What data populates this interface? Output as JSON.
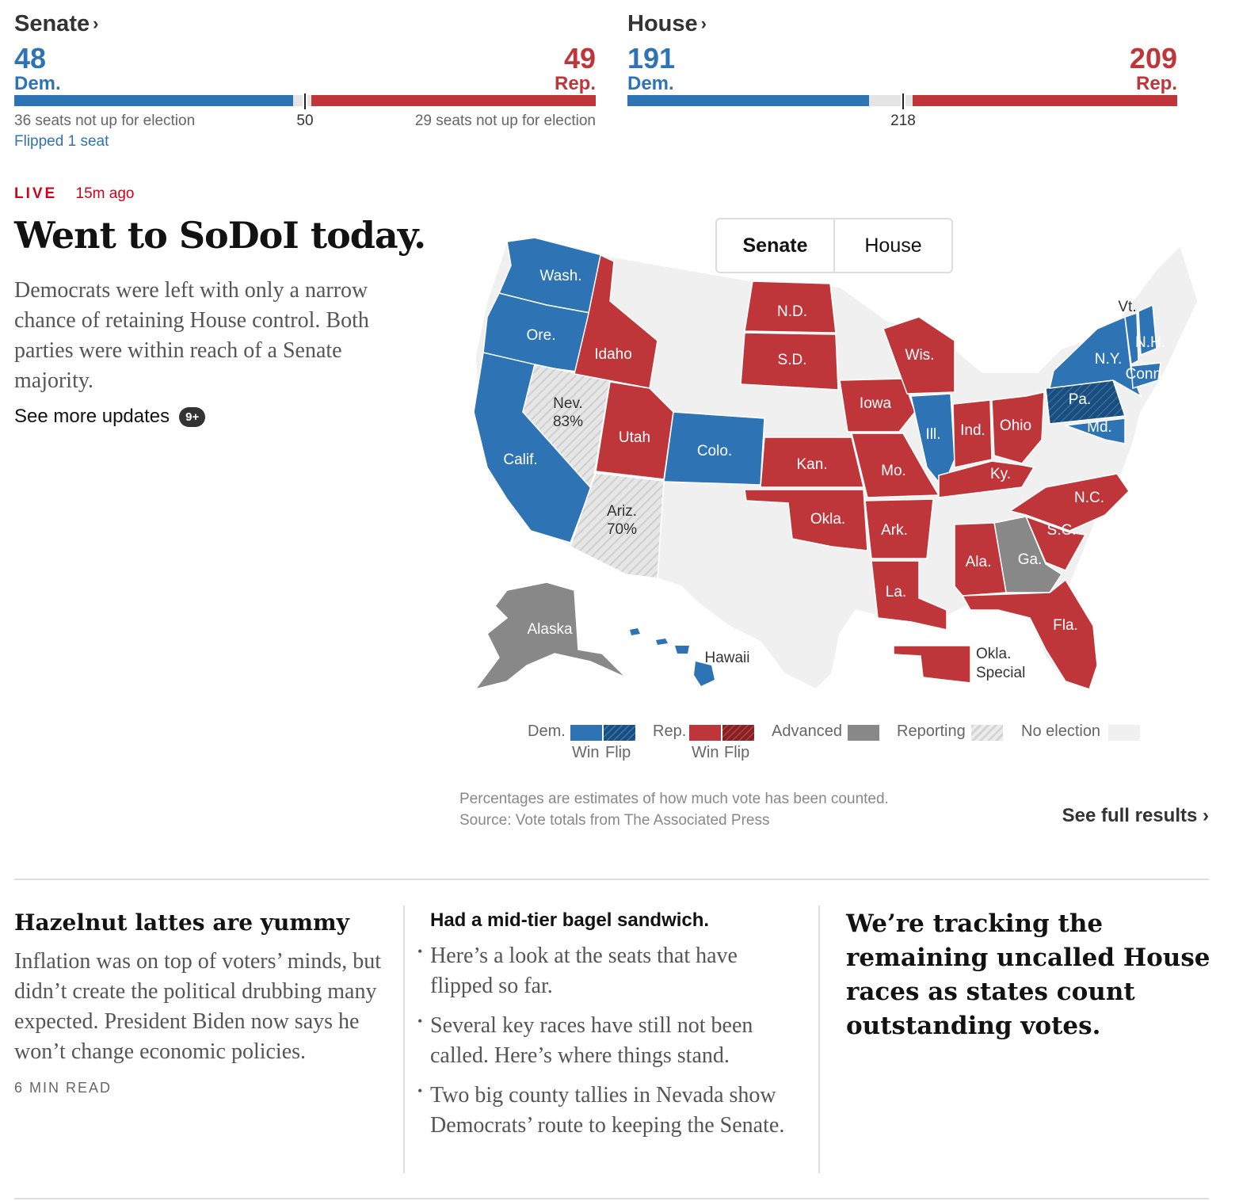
{
  "senate": {
    "title": "Senate",
    "dem_count": "48",
    "dem_label": "Dem.",
    "rep_count": "49",
    "rep_label": "Rep.",
    "majority": "50",
    "dem_note": "36 seats not up for election",
    "rep_note": "29 seats not up for election",
    "flip_note": "Flipped 1 seat",
    "dem_fraction": 0.48,
    "rep_fraction": 0.49
  },
  "house": {
    "title": "House",
    "dem_count": "191",
    "dem_label": "Dem.",
    "rep_count": "209",
    "rep_label": "Rep.",
    "majority": "218",
    "dem_fraction": 0.439,
    "rep_fraction": 0.48
  },
  "story": {
    "live": "LIVE",
    "time_ago": "15m ago",
    "headline": "Went to SoDoI today.",
    "summary": "Democrats were left with only a narrow chance of retaining House control. Both parties were within reach of a Senate majority.",
    "more_label": "See more updates",
    "more_badge": "9+"
  },
  "map": {
    "toggle": [
      "Senate",
      "House"
    ],
    "selected": "Senate",
    "colors": {
      "dem": "#2e74b5",
      "dem_flip": "#1d4d7a",
      "rep": "#bf363a",
      "rep_flip": "#7f2426",
      "advanced": "#888888",
      "reporting": "#dddddd",
      "none": "#f0f0f0"
    },
    "labels": {
      "wash": "Wash.",
      "ore": "Ore.",
      "idaho": "Idaho",
      "calif": "Calif.",
      "nev": "Nev.",
      "nev_pct": "83%",
      "utah": "Utah",
      "ariz": "Ariz.",
      "ariz_pct": "70%",
      "colo": "Colo.",
      "nd": "N.D.",
      "sd": "S.D.",
      "kan": "Kan.",
      "okla": "Okla.",
      "iowa": "Iowa",
      "mo": "Mo.",
      "ark": "Ark.",
      "la": "La.",
      "wis": "Wis.",
      "ill": "Ill.",
      "ind": "Ind.",
      "ohio": "Ohio",
      "ky": "Ky.",
      "pa": "Pa.",
      "md": "Md.",
      "ny": "N.Y.",
      "vt": "Vt.",
      "nh": "N.H.",
      "conn": "Conn.",
      "nc": "N.C.",
      "sc": "S.C.",
      "ga": "Ga.",
      "ala": "Ala.",
      "fla": "Fla.",
      "alaska": "Alaska",
      "hawaii": "Hawaii",
      "okla_special_1": "Okla.",
      "okla_special_2": "Special"
    },
    "legend": {
      "dem": "Dem.",
      "rep": "Rep.",
      "win": "Win",
      "flip": "Flip",
      "advanced": "Advanced",
      "reporting": "Reporting",
      "none": "No election"
    },
    "note_1": "Percentages are estimates of how much vote has been counted.",
    "note_2": "Source: Vote totals from The Associated Press",
    "full_results": "See full results"
  },
  "columns": {
    "c1_head": "Hazelnut lattes are yummy",
    "c1_body": "Inflation was on top of voters’ minds, but didn’t create the political drubbing many expected. President Biden now says he won’t change economic policies.",
    "c1_meta": "6 MIN READ",
    "c2_head": "Had a mid-tier bagel sandwich.",
    "c2_bullets": [
      "Here’s a look at the seats that have flipped so far.",
      "Several key races have still not been called. Here’s where things stand.",
      "Two big county tallies in Nevada show Democrats’ route to keeping the Senate."
    ],
    "c3_head": "We’re tracking the remaining uncalled House races as states count outstanding votes."
  }
}
